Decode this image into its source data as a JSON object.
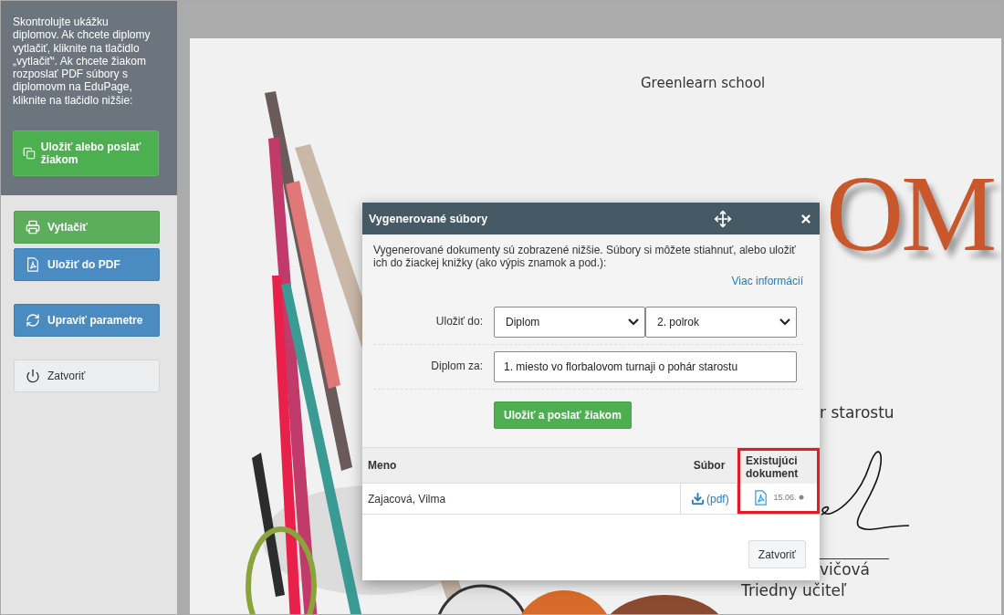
{
  "sidebar": {
    "instructions": "Skontrolujte ukážku diplomov. Ak chcete diplomy vytlačiť, kliknite na tlačidlo „vytlačiť“. Ak chcete žiakom rozposlať PDF súbory s diplomovm na EduPage, kliknite na tlačidlo nižšie:",
    "send_button": "Uložiť alebo poslať žiakom",
    "buttons": [
      {
        "kind": "success",
        "label": "Vytlačiť"
      },
      {
        "kind": "primary",
        "label": "Uložiť do PDF"
      },
      {
        "kind": "primary",
        "label": "Upraviť parametre"
      },
      {
        "kind": "default",
        "label": "Zatvoriť"
      }
    ]
  },
  "diploma": {
    "school": "Greenlearn school",
    "title": "OM",
    "reason": "r starostu",
    "teacher_name": "vičová",
    "teacher_role": "Triedny učiteľ"
  },
  "dialog": {
    "title": "Vygenerované súbory",
    "description": "Vygenerované dokumenty sú zobrazené nižšie. Súbory si môžete stiahnuť, alebo uložiť ich do žiackej knižky (ako výpis znamok a pod.):",
    "more_link": "Viac informácií",
    "save_to": {
      "label": "Uložiť do:",
      "selects": [
        "Diplom",
        "2. polrok"
      ]
    },
    "diploma_for": {
      "label": "Diplom za:",
      "value": "1. miesto vo florbalovom turnaji o pohár starostu"
    },
    "submit_button": "Uložiť a poslať žiakom",
    "table": {
      "columns": [
        {
          "label": "Meno",
          "highlighted": false
        },
        {
          "label": "Súbor",
          "highlighted": false
        },
        {
          "label": "Existujúci dokument",
          "highlighted": true
        }
      ],
      "rows": [
        {
          "name": "Zajacová, Vilma",
          "file": "(pdf)",
          "existing_date": "15.06."
        }
      ]
    },
    "close_button": "Zatvoriť"
  }
}
